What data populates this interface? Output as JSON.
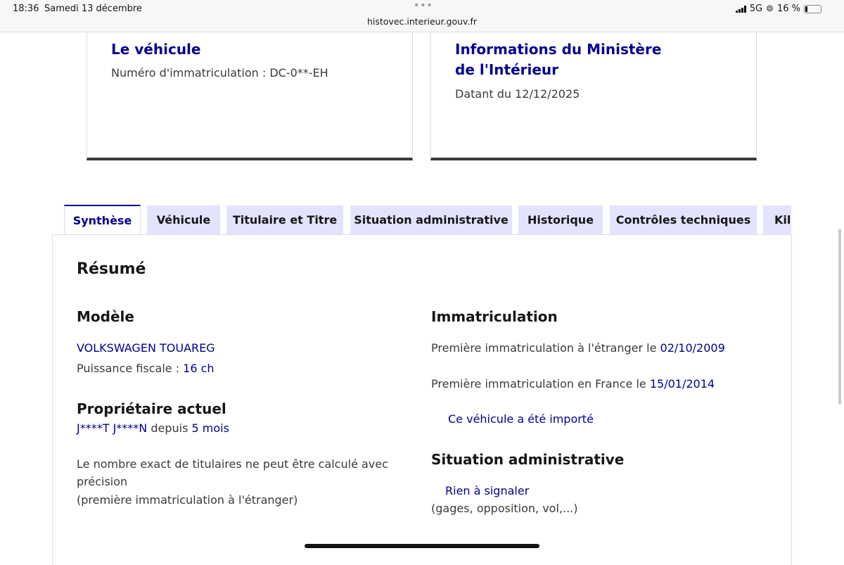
{
  "status_bar": {
    "time": "18:36",
    "date": "Samedi 13 décembre",
    "url": "histovec.interieur.gouv.fr",
    "network": "5G",
    "battery": "16 %",
    "battery_level": 16
  },
  "cards": [
    {
      "title": "Le véhicule",
      "text": "Numéro d'immatriculation : DC-0**-EH"
    },
    {
      "title": "Informations du Ministère de l'Intérieur",
      "text": "Datant du 12/12/2025"
    }
  ],
  "tabs": [
    "Synthèse",
    "Véhicule",
    "Titulaire et Titre",
    "Situation administrative",
    "Historique",
    "Contrôles techniques",
    "Kilométrage"
  ],
  "active_tab": "Synthèse",
  "summary": {
    "title": "Résumé",
    "model": {
      "heading": "Modèle",
      "name": "VOLKSWAGEN TOUAREG",
      "power_label": "Puissance fiscale :",
      "power_value": "16 ch"
    },
    "owner": {
      "heading": "Propriétaire actuel",
      "name": "J****T J****N",
      "since_label": "depuis",
      "since_value": "5 mois",
      "note1": "Le nombre exact de titulaires ne peut être calculé avec",
      "note2": "précision",
      "note3": "(première immatriculation à l'étranger)"
    },
    "registration": {
      "heading": "Immatriculation",
      "foreign_label": "Première immatriculation à l'étranger le",
      "foreign_date": "02/10/2009",
      "france_label": "Première immatriculation en France le",
      "france_date": "15/01/2014",
      "imported": "Ce véhicule a été importé"
    },
    "admin": {
      "heading": "Situation administrative",
      "status": "Rien à signaler",
      "detail": "(gages, opposition, vol,...)"
    }
  }
}
